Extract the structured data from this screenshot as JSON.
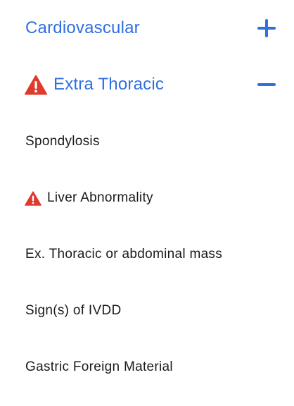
{
  "colors": {
    "accent": "#2f6fe0",
    "warning": "#e03a2f",
    "text": "#1a1a1a"
  },
  "sections": [
    {
      "title": "Cardiovascular",
      "toggle_icon": "plus-icon",
      "expanded": false,
      "warning": false
    },
    {
      "title": "Extra Thoracic",
      "toggle_icon": "minus-icon",
      "expanded": true,
      "warning": true,
      "items": [
        {
          "label": "Spondylosis",
          "warning": false
        },
        {
          "label": "Liver Abnormality",
          "warning": true
        },
        {
          "label": "Ex. Thoracic or abdominal mass",
          "warning": false
        },
        {
          "label": "Sign(s) of IVDD",
          "warning": false
        },
        {
          "label": "Gastric Foreign Material",
          "warning": false
        }
      ]
    }
  ]
}
